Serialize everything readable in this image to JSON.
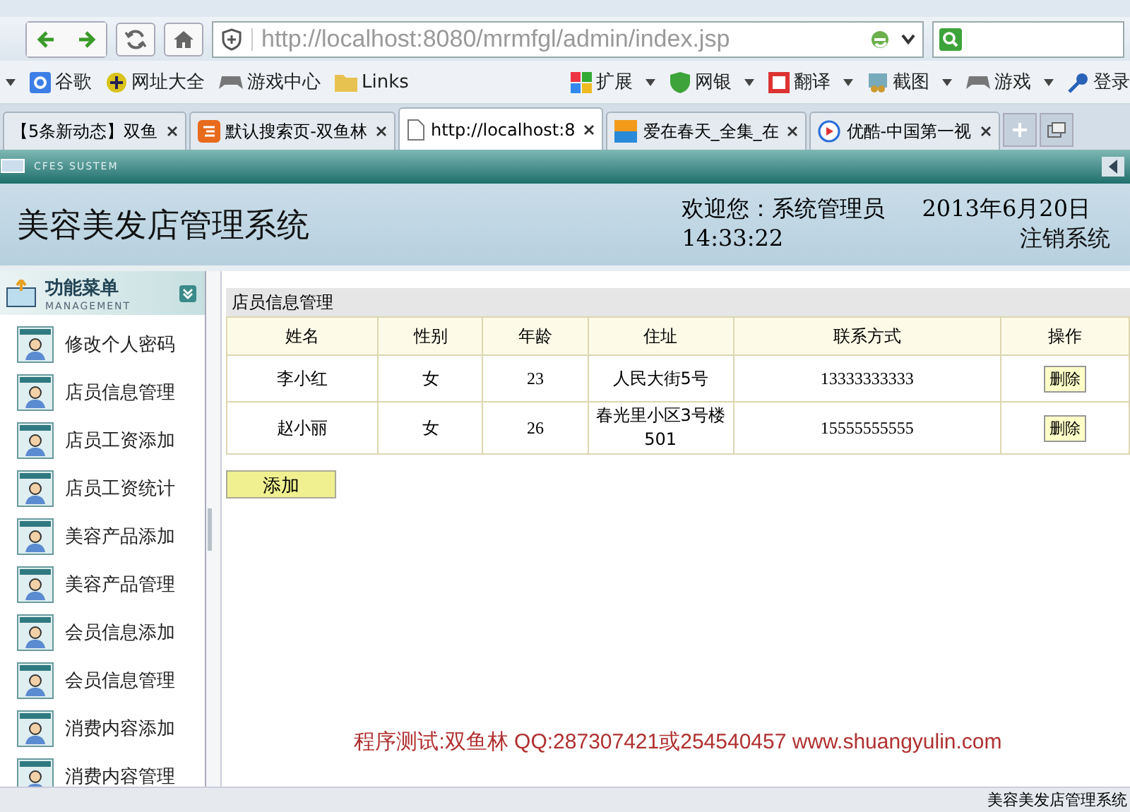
{
  "browser": {
    "address": "http://localhost:8080/mrmfgl/admin/index.jsp",
    "bookmarks": [
      "谷歌",
      "网址大全",
      "游戏中心",
      "Links"
    ],
    "tools": [
      "扩展",
      "网银",
      "翻译",
      "截图",
      "游戏",
      "登录"
    ],
    "tabs": [
      {
        "label": "【5条新动态】双鱼",
        "selected": false
      },
      {
        "label": "默认搜索页-双鱼林",
        "selected": false
      },
      {
        "label": "http://localhost:8",
        "selected": true
      },
      {
        "label": "爱在春天_全集_在",
        "selected": false
      },
      {
        "label": "优酷-中国第一视",
        "selected": false
      }
    ]
  },
  "app": {
    "system_label": "CFES SUSTEM",
    "title": "美容美发店管理系统",
    "welcome": "欢迎您：系统管理员",
    "date": "2013年6月20日",
    "time": "14:33:22",
    "logout": "注销系统"
  },
  "sidebar": {
    "title": "功能菜单",
    "subtitle": "MANAGEMENT",
    "items": [
      "修改个人密码",
      "店员信息管理",
      "店员工资添加",
      "店员工资统计",
      "美容产品添加",
      "美容产品管理",
      "会员信息添加",
      "会员信息管理",
      "消费内容添加",
      "消费内容管理"
    ]
  },
  "panel": {
    "title": "店员信息管理",
    "table": {
      "columns": [
        "姓名",
        "性别",
        "年龄",
        "住址",
        "联系方式",
        "操作"
      ],
      "rows": [
        {
          "name": "李小红",
          "gender": "女",
          "age": "23",
          "address": "人民大街5号",
          "phone": "13333333333",
          "action": "删除"
        },
        {
          "name": "赵小丽",
          "gender": "女",
          "age": "26",
          "address": "春光里小区3号楼501",
          "phone": "15555555555",
          "action": "删除"
        }
      ]
    },
    "add_button": "添加"
  },
  "footer": "程序测试:双鱼林 QQ:287307421或254540457 www.shuangyulin.com",
  "status_bar": "美容美发店管理系统"
}
